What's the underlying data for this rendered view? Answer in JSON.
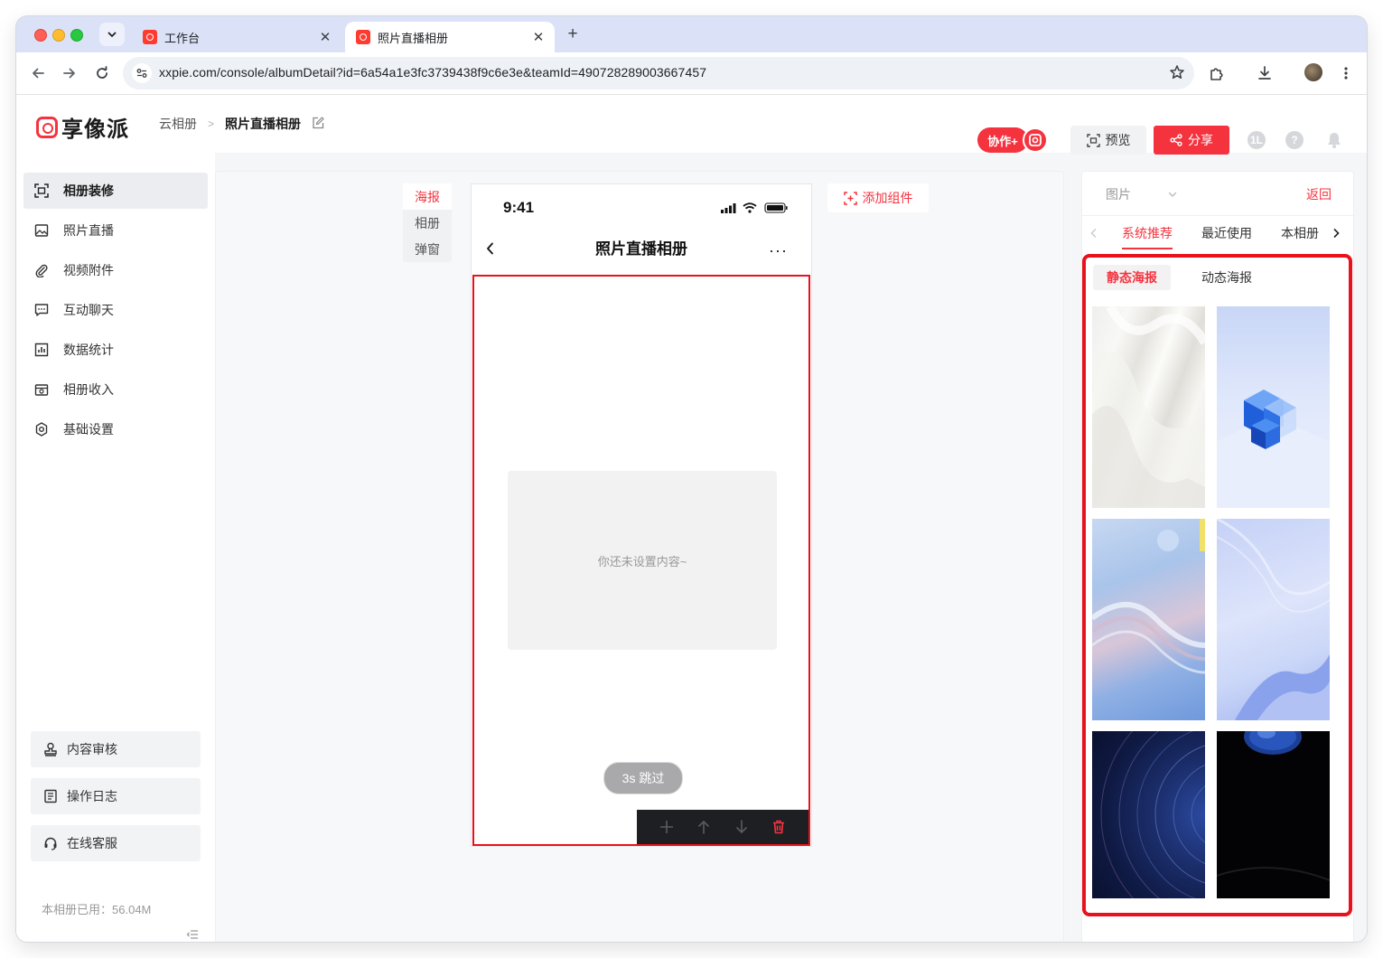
{
  "browser": {
    "tabs": [
      {
        "title": "工作台",
        "active": false
      },
      {
        "title": "照片直播相册",
        "active": true
      }
    ],
    "url": "xxpie.com/console/albumDetail?id=6a54a1e3fc3739438f9c6e3e&teamId=490728289003667457"
  },
  "header": {
    "logo_text": "享像派",
    "breadcrumb_root": "云相册",
    "breadcrumb_current": "照片直播相册",
    "collab_label": "协作+",
    "preview_label": "预览",
    "share_label": "分享",
    "user_badge": "1L"
  },
  "sidebar": {
    "items": [
      {
        "label": "相册装修",
        "icon": "scan-icon",
        "active": true
      },
      {
        "label": "照片直播",
        "icon": "image-icon",
        "active": false
      },
      {
        "label": "视频附件",
        "icon": "paperclip-icon",
        "active": false
      },
      {
        "label": "互动聊天",
        "icon": "chat-icon",
        "active": false
      },
      {
        "label": "数据统计",
        "icon": "stats-icon",
        "active": false
      },
      {
        "label": "相册收入",
        "icon": "income-icon",
        "active": false
      },
      {
        "label": "基础设置",
        "icon": "settings-icon",
        "active": false
      }
    ],
    "bottom_buttons": [
      {
        "label": "内容审核",
        "icon": "stamp-icon"
      },
      {
        "label": "操作日志",
        "icon": "log-icon"
      },
      {
        "label": "在线客服",
        "icon": "headset-icon"
      }
    ],
    "storage_label": "本相册已用：",
    "storage_value": "56.04M"
  },
  "editor": {
    "section_tabs": [
      "海报",
      "相册",
      "弹窗"
    ],
    "active_section": "海报",
    "add_component_label": "添加组件",
    "phone": {
      "time": "9:41",
      "title": "照片直播相册",
      "more": "···",
      "empty_text": "你还未设置内容~",
      "skip_label": "3s 跳过"
    }
  },
  "right_panel": {
    "select_label": "图片",
    "back_label": "返回",
    "tabs": [
      "系统推荐",
      "最近使用",
      "本相册"
    ],
    "active_tab": "系统推荐",
    "sub_tabs": [
      "静态海报",
      "动态海报"
    ],
    "active_sub_tab": "静态海报",
    "posters": [
      {
        "name": "white-waves"
      },
      {
        "name": "blue-cubes"
      },
      {
        "name": "light-blue-wave"
      },
      {
        "name": "blue-silk"
      },
      {
        "name": "star-trails"
      },
      {
        "name": "dark-planet"
      }
    ]
  },
  "colors": {
    "accent": "#f5333f",
    "highlight_border": "#e8121d",
    "tabstrip": "#dbe2f7",
    "sidebar_active": "#ebedf0"
  }
}
